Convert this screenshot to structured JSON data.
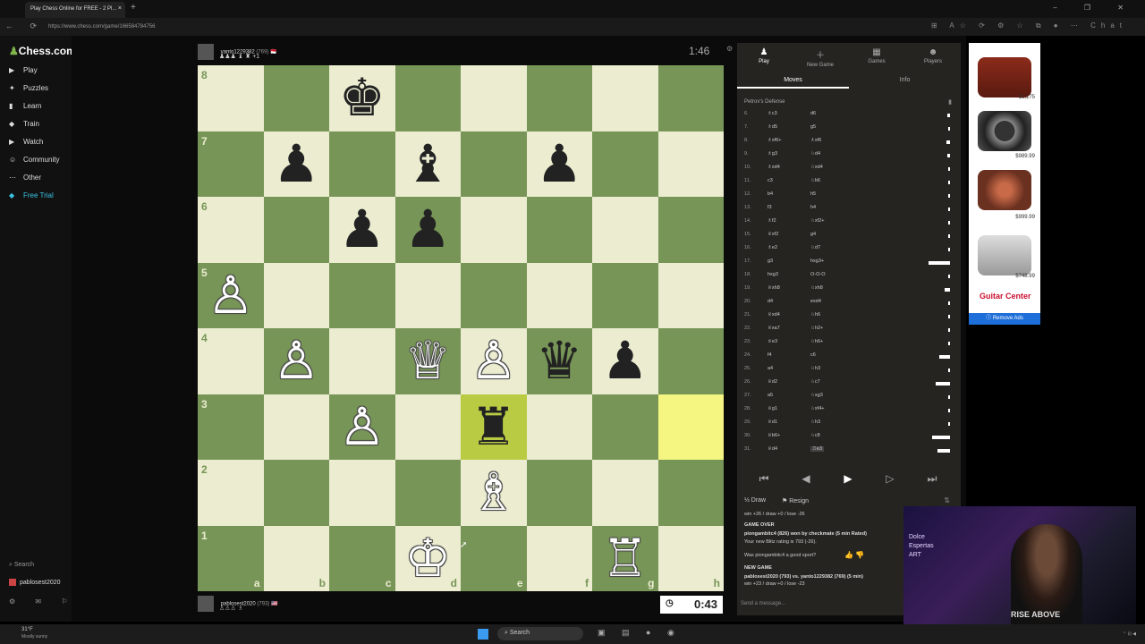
{
  "browser": {
    "tab_title": "Play Chess Online for FREE - 2 Pl...",
    "tab_close": "×",
    "new_tab": "+",
    "url": "https://www.chess.com/game/166584784756",
    "nav_icons": "← ⟳",
    "ext_icons": "⊞ A☆ ⟳ ⚙ ☆ ⧉ ● ⋯",
    "chat_label": "Chat",
    "window_controls": "– ❐ ✕"
  },
  "sidebar": {
    "logo_pawn": "♟",
    "logo_text": "Chess.com",
    "items": [
      {
        "icon": "▶",
        "label": "Play"
      },
      {
        "icon": "✦",
        "label": "Puzzles"
      },
      {
        "icon": "▮",
        "label": "Learn"
      },
      {
        "icon": "◆",
        "label": "Train"
      },
      {
        "icon": "▶",
        "label": "Watch"
      },
      {
        "icon": "☺",
        "label": "Community"
      },
      {
        "icon": "⋯",
        "label": "Other"
      },
      {
        "icon": "◆",
        "label": "Free Trial"
      }
    ],
    "search": "Search",
    "username": "pablosest2020",
    "bottom_icons": "⚙ ✉ ⚐ ⚙"
  },
  "game": {
    "opponent": {
      "name": "yanto1229382",
      "rating": "(769)",
      "flag": "🇲🇨",
      "captured": "♟♟♟ ♝ ♜ +1"
    },
    "me": {
      "name": "pablosest2020",
      "rating": "(793)",
      "flag": "🇺🇸",
      "captured": "♙♙♙ ♗"
    },
    "opponent_clock": "1:46",
    "my_clock": "0:43",
    "clock_icon": "◷",
    "ranks": [
      "8",
      "7",
      "6",
      "5",
      "4",
      "3",
      "2",
      "1"
    ],
    "files": [
      "a",
      "b",
      "c",
      "d",
      "e",
      "f",
      "g",
      "h"
    ],
    "pieces": [
      {
        "sq": "c8",
        "p": "♚",
        "c": "b"
      },
      {
        "sq": "b7",
        "p": "♟",
        "c": "b"
      },
      {
        "sq": "d7",
        "p": "♝",
        "c": "b"
      },
      {
        "sq": "f7",
        "p": "♟",
        "c": "b"
      },
      {
        "sq": "c6",
        "p": "♟",
        "c": "b"
      },
      {
        "sq": "d6",
        "p": "♟",
        "c": "b"
      },
      {
        "sq": "a5",
        "p": "♙",
        "c": "w"
      },
      {
        "sq": "b4",
        "p": "♙",
        "c": "w"
      },
      {
        "sq": "d4",
        "p": "♕",
        "c": "w"
      },
      {
        "sq": "e4",
        "p": "♙",
        "c": "w"
      },
      {
        "sq": "f4",
        "p": "♛",
        "c": "b"
      },
      {
        "sq": "g4",
        "p": "♟",
        "c": "b"
      },
      {
        "sq": "c3",
        "p": "♙",
        "c": "w"
      },
      {
        "sq": "e3",
        "p": "♜",
        "c": "b"
      },
      {
        "sq": "e2",
        "p": "♗",
        "c": "w"
      },
      {
        "sq": "d1",
        "p": "♔",
        "c": "w"
      },
      {
        "sq": "g1",
        "p": "♖",
        "c": "w"
      }
    ],
    "highlights": [
      "e3",
      "h3"
    ]
  },
  "panel": {
    "tabs": [
      {
        "icon": "♟",
        "label": "Play"
      },
      {
        "icon": "＋",
        "label": "New Game"
      },
      {
        "icon": "▦",
        "label": "Games"
      },
      {
        "icon": "☻",
        "label": "Players"
      }
    ],
    "subtab_moves": "Moves",
    "subtab_info": "Info",
    "opening": "Petrov's Defense",
    "moves": [
      {
        "n": "6.",
        "w": "♗c3",
        "b": "d6",
        "bar": 0.08
      },
      {
        "n": "7.",
        "w": "♗d5",
        "b": "g5",
        "bar": 0.06
      },
      {
        "n": "8.",
        "w": "♗xf6+",
        "b": "♗xf6",
        "bar": 0.1
      },
      {
        "n": "9.",
        "w": "♗g3",
        "b": "♘d4",
        "bar": 0.08
      },
      {
        "n": "10.",
        "w": "♗xd4",
        "b": "♘xd4",
        "bar": 0.06
      },
      {
        "n": "11.",
        "w": "c3",
        "b": "♘b6",
        "bar": 0.05
      },
      {
        "n": "12.",
        "w": "b4",
        "b": "h5",
        "bar": 0.05
      },
      {
        "n": "13.",
        "w": "f3",
        "b": "h4",
        "bar": 0.05
      },
      {
        "n": "14.",
        "w": "♗f2",
        "b": "♘xf2+",
        "bar": 0.05
      },
      {
        "n": "15.",
        "w": "♕xf2",
        "b": "g4",
        "bar": 0.05
      },
      {
        "n": "16.",
        "w": "♗e2",
        "b": "♘d7",
        "bar": 0.05
      },
      {
        "n": "17.",
        "w": "g3",
        "b": "hxg3+",
        "bar": 0.6
      },
      {
        "n": "18.",
        "w": "hxg3",
        "b": "O-O-O",
        "bar": 0.05
      },
      {
        "n": "19.",
        "w": "♕xh8",
        "b": "♘xh8",
        "bar": 0.15
      },
      {
        "n": "20.",
        "w": "d4",
        "b": "exd4",
        "bar": 0.05
      },
      {
        "n": "21.",
        "w": "♕xd4",
        "b": "♘h6",
        "bar": 0.05
      },
      {
        "n": "22.",
        "w": "♕xa7",
        "b": "♘h2+",
        "bar": 0.05
      },
      {
        "n": "23.",
        "w": "♕e3",
        "b": "♘h6+",
        "bar": 0.05
      },
      {
        "n": "24.",
        "w": "f4",
        "b": "c6",
        "bar": 0.3
      },
      {
        "n": "25.",
        "w": "a4",
        "b": "♘h3",
        "bar": 0.05
      },
      {
        "n": "26.",
        "w": "♕d2",
        "b": "♘c7",
        "bar": 0.4
      },
      {
        "n": "27.",
        "w": "a5",
        "b": "♘xg3",
        "bar": 0.05
      },
      {
        "n": "28.",
        "w": "♕g1",
        "b": "♘xf4+",
        "bar": 0.05
      },
      {
        "n": "29.",
        "w": "♕d1",
        "b": "♘h3",
        "bar": 0.05
      },
      {
        "n": "30.",
        "w": "♕b6+",
        "b": "♘c8",
        "bar": 0.5
      },
      {
        "n": "31.",
        "w": "♕d4",
        "b": "♖e3",
        "bar": 0.35
      }
    ],
    "controls": [
      "⏮",
      "◀",
      "▶",
      "▷",
      "⏭"
    ],
    "draw": "½ Draw",
    "resign": "⚑ Resign",
    "chat": [
      {
        "t": "win +26 / draw +0 / lose -26",
        "b": false
      },
      {
        "t": "GAME OVER",
        "b": true
      },
      {
        "t": "piongambitc4 (826) won by checkmate (5 min Rated)",
        "b": true
      },
      {
        "t": "Your new Blitz rating is 793 (-26).",
        "b": false
      },
      {
        "t": "Was piongambitc4 a good sport?",
        "b": false
      },
      {
        "t": "NEW GAME",
        "b": true
      },
      {
        "t": "pablosest2020 (793) vs. yanto1229382 (769) (5 min)",
        "b": true
      },
      {
        "t": "win +23 / draw +0 / lose -23",
        "b": false
      }
    ],
    "chat_placeholder": "Send a message..."
  },
  "ad": {
    "prices": [
      "$1,175",
      "$989.99",
      "$999.99",
      "$748.99"
    ],
    "brand": "Guitar Center",
    "remove": "ⓘ Remove Ads"
  },
  "webcam": {
    "sign": "Dolce\nEspertas\nART",
    "shirt": "RISE ABOVE"
  },
  "taskbar": {
    "temp": "31°F",
    "weather": "Mostly sunny",
    "search": "⌕ Search",
    "apps": "▣ ▤ ● ◉",
    "tray": "⌃ ⊡ ◀"
  }
}
